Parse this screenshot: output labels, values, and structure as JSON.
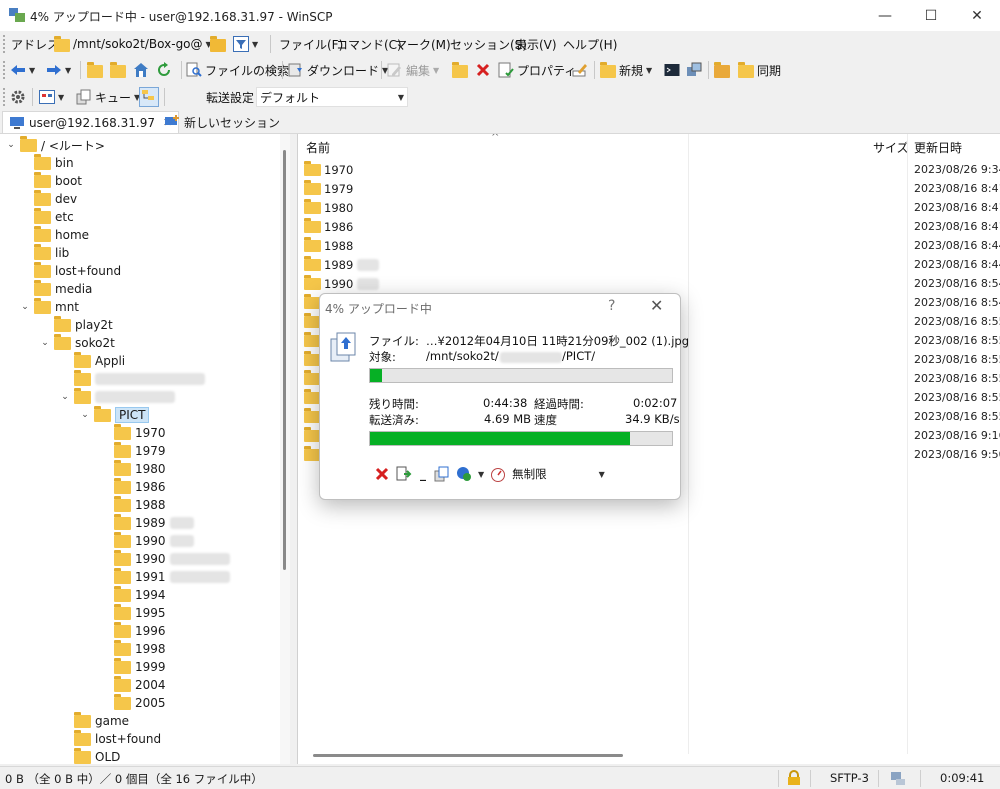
{
  "window": {
    "title": "4% アップロード中 - user@192.168.31.97 - WinSCP",
    "minimize_glyph": "—",
    "maximize_glyph": "☐",
    "close_glyph": "✕"
  },
  "address_bar": {
    "label": "アドレス",
    "value": "/mnt/soko2t/Box-go@",
    "menu": [
      "ファイル(F)",
      "コマンド(C)",
      "マーク(M)",
      "セッション(S)",
      "表示(V)",
      "ヘルプ(H)"
    ]
  },
  "toolbar2": {
    "find_files": "ファイルの検索",
    "download": "ダウンロード",
    "edit": "編集",
    "properties": "プロパティ",
    "new": "新規",
    "sync": "同期"
  },
  "toolbar3": {
    "queue": "キュー",
    "transfer_label": "転送設定",
    "transfer_value": "デフォルト"
  },
  "tabs": {
    "session": "user@192.168.31.97",
    "new_session": "新しいセッション",
    "close_glyph": "✕"
  },
  "tree": {
    "root": "/ <ルート>",
    "top": [
      "bin",
      "boot",
      "dev",
      "etc",
      "home",
      "lib",
      "lost+found",
      "media",
      "mnt"
    ],
    "mnt_children": [
      "play2t",
      "soko2t"
    ],
    "soko2t_children": [
      "Appli"
    ],
    "pict": "PICT",
    "pict_children": [
      "1970",
      "1979",
      "1980",
      "1986",
      "1988",
      "1989",
      "1990",
      "1990",
      "1991",
      "1994",
      "1995",
      "1996",
      "1998",
      "1999",
      "2004",
      "2005"
    ],
    "after": [
      "game",
      "lost+found",
      "OLD"
    ]
  },
  "list": {
    "col_name": "名前",
    "col_size": "サイズ",
    "col_date": "更新日時",
    "rows": [
      {
        "name": "1970",
        "date": "2023/08/26 9:34:"
      },
      {
        "name": "1979",
        "date": "2023/08/16 8:41:"
      },
      {
        "name": "1980",
        "date": "2023/08/16 8:41:"
      },
      {
        "name": "1986",
        "date": "2023/08/16 8:41:"
      },
      {
        "name": "1988",
        "date": "2023/08/16 8:44:"
      },
      {
        "name": "1989",
        "date": "2023/08/16 8:44:"
      },
      {
        "name": "1990",
        "date": "2023/08/16 8:54:"
      },
      {
        "name": "",
        "date": "2023/08/16 8:54:"
      },
      {
        "name": "",
        "date": "2023/08/16 8:55:"
      },
      {
        "name": "",
        "date": "2023/08/16 8:55:"
      },
      {
        "name": "",
        "date": "2023/08/16 8:55:"
      },
      {
        "name": "",
        "date": "2023/08/16 8:55:"
      },
      {
        "name": "",
        "date": "2023/08/16 8:55:"
      },
      {
        "name": "",
        "date": "2023/08/16 8:55:"
      },
      {
        "name": "",
        "date": "2023/08/16 9:16:"
      },
      {
        "name": "",
        "date": "2023/08/16 9:50:"
      }
    ]
  },
  "dialog": {
    "title": "4% アップロード中",
    "help": "?",
    "close": "✕",
    "file_label": "ファイル:",
    "file_value": "…¥2012年04月10日 11時21分09秒_002 (1).jpg",
    "target_label": "対象:",
    "target_prefix": "/mnt/soko2t/",
    "target_suffix": "/PICT/",
    "file_progress": 0.04,
    "remaining_label": "残り時間:",
    "remaining_value": "0:44:38",
    "elapsed_label": "経過時間:",
    "elapsed_value": "0:02:07",
    "transferred_label": "転送済み:",
    "transferred_value": "4.69 MB",
    "speed_label": "速度",
    "speed_value": "34.9 KB/s",
    "total_progress": 0.86,
    "speed_limit": "無制限"
  },
  "status": {
    "left": "0 B （全 0 B 中）／ 0 個目（全 16 ファイル中）",
    "protocol": "SFTP-3",
    "time": "0:09:41"
  },
  "colors": {
    "progress_green": "#06b025",
    "folder_yellow": "#f5c64a",
    "selection_blue": "#cce4f7"
  }
}
